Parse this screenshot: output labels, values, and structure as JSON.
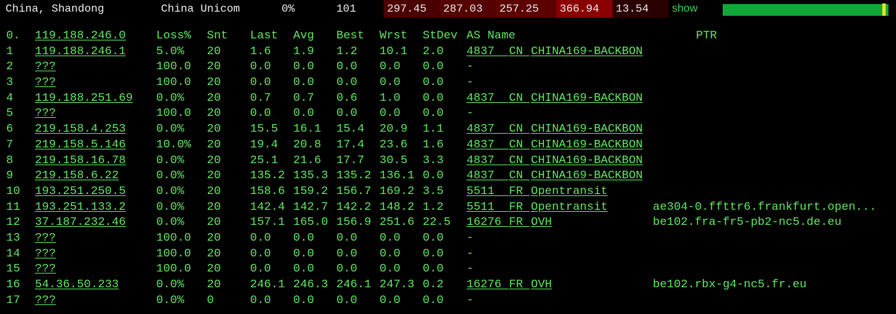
{
  "summary": {
    "location": "China, Shandong",
    "isp": "China Unicom",
    "loss": "0%",
    "sent": "101",
    "latencies": [
      "297.45",
      "287.03",
      "257.25",
      "366.94",
      "13.54"
    ],
    "show_label": "show",
    "colors": {
      "red1": "#4a0000",
      "red2": "#5e0000",
      "red3": "#6a0000",
      "red4": "#8a0000",
      "red5": "#2a0000",
      "spark": "#11a83a",
      "spark_mark": "#e3e321"
    }
  },
  "table": {
    "headers": {
      "hop": "0.",
      "host": "119.188.246.0",
      "loss": "Loss%",
      "snt": "Snt",
      "last": "Last",
      "avg": "Avg",
      "best": "Best",
      "wrst": "Wrst",
      "stdev": "StDev",
      "asname": "AS Name",
      "ptr": "PTR"
    },
    "rows": [
      {
        "hop": "1",
        "host": "119.188.246.1",
        "loss": "5.0%",
        "snt": "20",
        "last": "1.6",
        "avg": "1.9",
        "best": "1.2",
        "wrst": "10.1",
        "stdev": "2.0",
        "asn": "4837",
        "cc": "CN",
        "asname": "CHINA169-BACKBON",
        "ptr": ""
      },
      {
        "hop": "2",
        "host": "???",
        "loss": "100.0",
        "snt": "20",
        "last": "0.0",
        "avg": "0.0",
        "best": "0.0",
        "wrst": "0.0",
        "stdev": "0.0",
        "asn": "-",
        "cc": "",
        "asname": "",
        "ptr": ""
      },
      {
        "hop": "3",
        "host": "???",
        "loss": "100.0",
        "snt": "20",
        "last": "0.0",
        "avg": "0.0",
        "best": "0.0",
        "wrst": "0.0",
        "stdev": "0.0",
        "asn": "-",
        "cc": "",
        "asname": "",
        "ptr": ""
      },
      {
        "hop": "4",
        "host": "119.188.251.69",
        "loss": "0.0%",
        "snt": "20",
        "last": "0.7",
        "avg": "0.7",
        "best": "0.6",
        "wrst": "1.0",
        "stdev": "0.0",
        "asn": "4837",
        "cc": "CN",
        "asname": "CHINA169-BACKBON",
        "ptr": ""
      },
      {
        "hop": "5",
        "host": "???",
        "loss": "100.0",
        "snt": "20",
        "last": "0.0",
        "avg": "0.0",
        "best": "0.0",
        "wrst": "0.0",
        "stdev": "0.0",
        "asn": "-",
        "cc": "",
        "asname": "",
        "ptr": ""
      },
      {
        "hop": "6",
        "host": "219.158.4.253",
        "loss": "0.0%",
        "snt": "20",
        "last": "15.5",
        "avg": "16.1",
        "best": "15.4",
        "wrst": "20.9",
        "stdev": "1.1",
        "asn": "4837",
        "cc": "CN",
        "asname": "CHINA169-BACKBON",
        "ptr": ""
      },
      {
        "hop": "7",
        "host": "219.158.5.146",
        "loss": "10.0%",
        "snt": "20",
        "last": "19.4",
        "avg": "20.8",
        "best": "17.4",
        "wrst": "23.6",
        "stdev": "1.6",
        "asn": "4837",
        "cc": "CN",
        "asname": "CHINA169-BACKBON",
        "ptr": ""
      },
      {
        "hop": "8",
        "host": "219.158.16.78",
        "loss": "0.0%",
        "snt": "20",
        "last": "25.1",
        "avg": "21.6",
        "best": "17.7",
        "wrst": "30.5",
        "stdev": "3.3",
        "asn": "4837",
        "cc": "CN",
        "asname": "CHINA169-BACKBON",
        "ptr": ""
      },
      {
        "hop": "9",
        "host": "219.158.6.22",
        "loss": "0.0%",
        "snt": "20",
        "last": "135.2",
        "avg": "135.3",
        "best": "135.2",
        "wrst": "136.1",
        "stdev": "0.0",
        "asn": "4837",
        "cc": "CN",
        "asname": "CHINA169-BACKBON",
        "ptr": ""
      },
      {
        "hop": "10",
        "host": "193.251.250.5",
        "loss": "0.0%",
        "snt": "20",
        "last": "158.6",
        "avg": "159.2",
        "best": "156.7",
        "wrst": "169.2",
        "stdev": "3.5",
        "asn": "5511",
        "cc": "FR",
        "asname": "Opentransit",
        "ptr": ""
      },
      {
        "hop": "11",
        "host": "193.251.133.2",
        "loss": "0.0%",
        "snt": "20",
        "last": "142.4",
        "avg": "142.7",
        "best": "142.2",
        "wrst": "148.2",
        "stdev": "1.2",
        "asn": "5511",
        "cc": "FR",
        "asname": "Opentransit",
        "ptr": "ae304-0.ffttr6.frankfurt.open..."
      },
      {
        "hop": "12",
        "host": "37.187.232.46",
        "loss": "0.0%",
        "snt": "20",
        "last": "157.1",
        "avg": "165.0",
        "best": "156.9",
        "wrst": "251.6",
        "stdev": "22.5",
        "asn": "16276",
        "cc": "FR",
        "asname": "OVH",
        "ptr": "be102.fra-fr5-pb2-nc5.de.eu"
      },
      {
        "hop": "13",
        "host": "???",
        "loss": "100.0",
        "snt": "20",
        "last": "0.0",
        "avg": "0.0",
        "best": "0.0",
        "wrst": "0.0",
        "stdev": "0.0",
        "asn": "-",
        "cc": "",
        "asname": "",
        "ptr": ""
      },
      {
        "hop": "14",
        "host": "???",
        "loss": "100.0",
        "snt": "20",
        "last": "0.0",
        "avg": "0.0",
        "best": "0.0",
        "wrst": "0.0",
        "stdev": "0.0",
        "asn": "-",
        "cc": "",
        "asname": "",
        "ptr": ""
      },
      {
        "hop": "15",
        "host": "???",
        "loss": "100.0",
        "snt": "20",
        "last": "0.0",
        "avg": "0.0",
        "best": "0.0",
        "wrst": "0.0",
        "stdev": "0.0",
        "asn": "-",
        "cc": "",
        "asname": "",
        "ptr": ""
      },
      {
        "hop": "16",
        "host": "54.36.50.233",
        "loss": "0.0%",
        "snt": "20",
        "last": "246.1",
        "avg": "246.3",
        "best": "246.1",
        "wrst": "247.3",
        "stdev": "0.2",
        "asn": "16276",
        "cc": "FR",
        "asname": "OVH",
        "ptr": "be102.rbx-g4-nc5.fr.eu"
      },
      {
        "hop": "17",
        "host": "???",
        "loss": "0.0%",
        "snt": "0",
        "last": "0.0",
        "avg": "0.0",
        "best": "0.0",
        "wrst": "0.0",
        "stdev": "0.0",
        "asn": "-",
        "cc": "",
        "asname": "",
        "ptr": ""
      }
    ]
  }
}
